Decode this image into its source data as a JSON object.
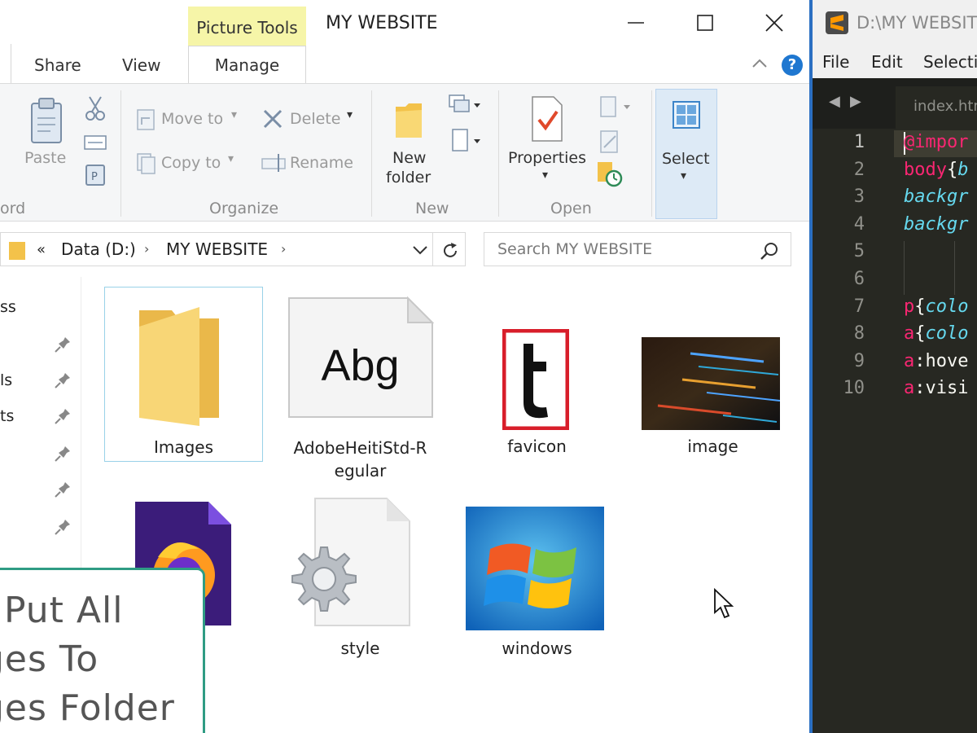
{
  "explorer": {
    "window_title": "MY WEBSITE",
    "contextual_tab_group": "Picture Tools",
    "ribbon_tabs": [
      "Share",
      "View",
      "Manage"
    ],
    "clipboard_group_label_fragment": "ord",
    "clipboard": {
      "paste": "Paste"
    },
    "organize": {
      "move_to": "Move to",
      "copy_to": "Copy to",
      "delete": "Delete",
      "rename": "Rename",
      "label": "Organize"
    },
    "new": {
      "new_folder_line1": "New",
      "new_folder_line2": "folder",
      "label": "New"
    },
    "open": {
      "properties": "Properties",
      "label": "Open"
    },
    "select": {
      "select": "Select"
    },
    "address": {
      "prefix": "«",
      "segments": [
        "Data (D:)",
        "MY WEBSITE"
      ]
    },
    "search": {
      "placeholder": "Search MY WEBSITE"
    },
    "nav_fragments": [
      "ss",
      "ls",
      "ts"
    ],
    "files": [
      {
        "name": "Images",
        "type": "folder"
      },
      {
        "name_line1": "AdobeHeitiStd-R",
        "name_line2": "egular",
        "type": "font",
        "preview": "Abg"
      },
      {
        "name": "favicon",
        "type": "image",
        "glyph": "t"
      },
      {
        "name": "image",
        "type": "image"
      },
      {
        "name": "style",
        "type": "css"
      },
      {
        "name": "windows",
        "type": "image"
      }
    ],
    "colors": {
      "accent": "#1f77d0",
      "picture_tools": "#f6f5a8",
      "selection": "#ddeaf6"
    }
  },
  "callout": {
    "lines": [
      "Put All",
      "ges To",
      "ges Folder"
    ]
  },
  "editor": {
    "title": "D:\\MY WEBSITE",
    "menu": [
      "File",
      "Edit",
      "Selectio"
    ],
    "tab": "index.htm",
    "lines": [
      {
        "n": "1",
        "parts": [
          {
            "t": "@impor",
            "c": "#f92672"
          }
        ]
      },
      {
        "n": "2",
        "parts": [
          {
            "t": "body",
            "c": "#f92672"
          },
          {
            "t": "{",
            "c": "#f8f8f2"
          },
          {
            "t": "b",
            "c": "#66d9ef",
            "i": true
          }
        ]
      },
      {
        "n": "3",
        "parts": [
          {
            "t": "backgr",
            "c": "#66d9ef",
            "i": true
          }
        ]
      },
      {
        "n": "4",
        "parts": [
          {
            "t": "backgr",
            "c": "#66d9ef",
            "i": true
          }
        ]
      },
      {
        "n": "5",
        "parts": []
      },
      {
        "n": "6",
        "parts": []
      },
      {
        "n": "7",
        "parts": [
          {
            "t": "p",
            "c": "#f92672"
          },
          {
            "t": "{",
            "c": "#f8f8f2"
          },
          {
            "t": "colo",
            "c": "#66d9ef",
            "i": true
          }
        ]
      },
      {
        "n": "8",
        "parts": [
          {
            "t": "a",
            "c": "#f92672"
          },
          {
            "t": "{",
            "c": "#f8f8f2"
          },
          {
            "t": "colo",
            "c": "#66d9ef",
            "i": true
          }
        ]
      },
      {
        "n": "9",
        "parts": [
          {
            "t": "a",
            "c": "#f92672"
          },
          {
            "t": ":hove",
            "c": "#f8f8f2"
          }
        ]
      },
      {
        "n": "10",
        "parts": [
          {
            "t": "a",
            "c": "#f92672"
          },
          {
            "t": ":visi",
            "c": "#f8f8f2"
          }
        ]
      }
    ]
  }
}
